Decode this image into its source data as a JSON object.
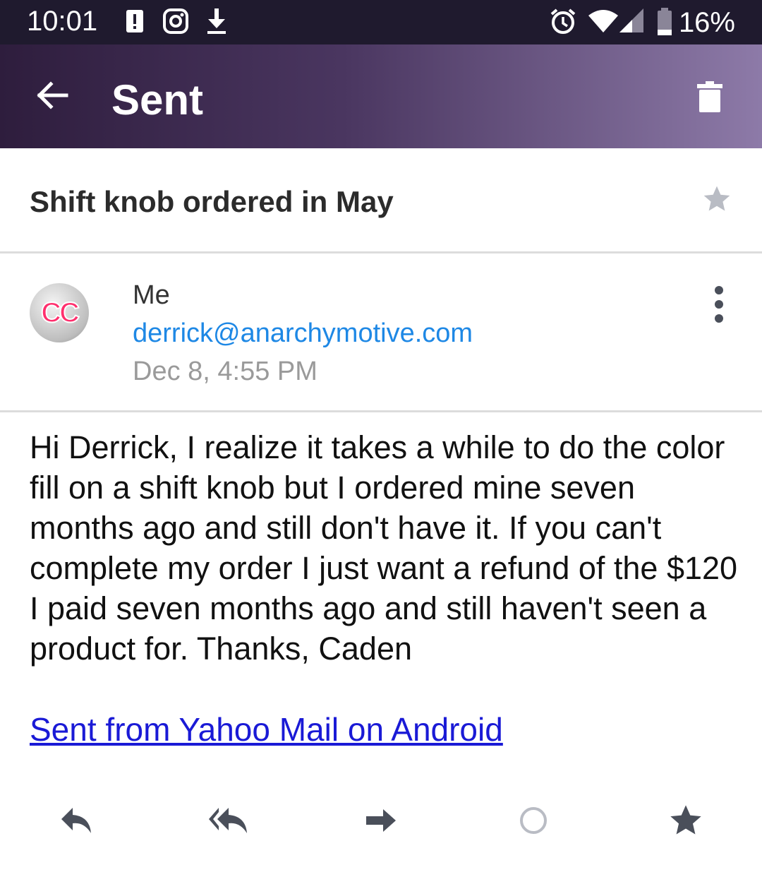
{
  "status_bar": {
    "time": "10:01",
    "battery": "16%",
    "icons": [
      "alert-icon",
      "instagram-icon",
      "download-icon",
      "alarm-icon",
      "wifi-icon",
      "signal-icon",
      "battery-icon"
    ]
  },
  "app_bar": {
    "title": "Sent",
    "back_icon": "back-arrow-icon",
    "action_icon": "trash-icon"
  },
  "message": {
    "subject": "Shift knob ordered in May",
    "sender": {
      "avatar_text": "CC",
      "name": "Me",
      "email": "derrick@anarchymotive.com",
      "date": "Dec 8, 4:55 PM"
    },
    "body": "Hi Derrick, I realize it takes a while to do the color fill on a shift knob but I ordered mine seven months ago and still don't have it. If you can't complete my order I just want a refund of the $120 I paid seven months ago and still haven't seen a product for. Thanks, Caden",
    "signature_link": "Sent from Yahoo Mail on Android"
  },
  "toolbar": {
    "actions": [
      "reply-icon",
      "reply-all-icon",
      "forward-icon",
      "mark-unread-icon",
      "star-icon"
    ]
  },
  "colors": {
    "status_bar": "#1f1a2e",
    "app_bar_start": "#2e1d3d",
    "app_bar_end": "#8d7aa8",
    "link": "#1e88e5",
    "signature_link": "#1a1ad6",
    "icon_gray": "#4a4f5a"
  }
}
